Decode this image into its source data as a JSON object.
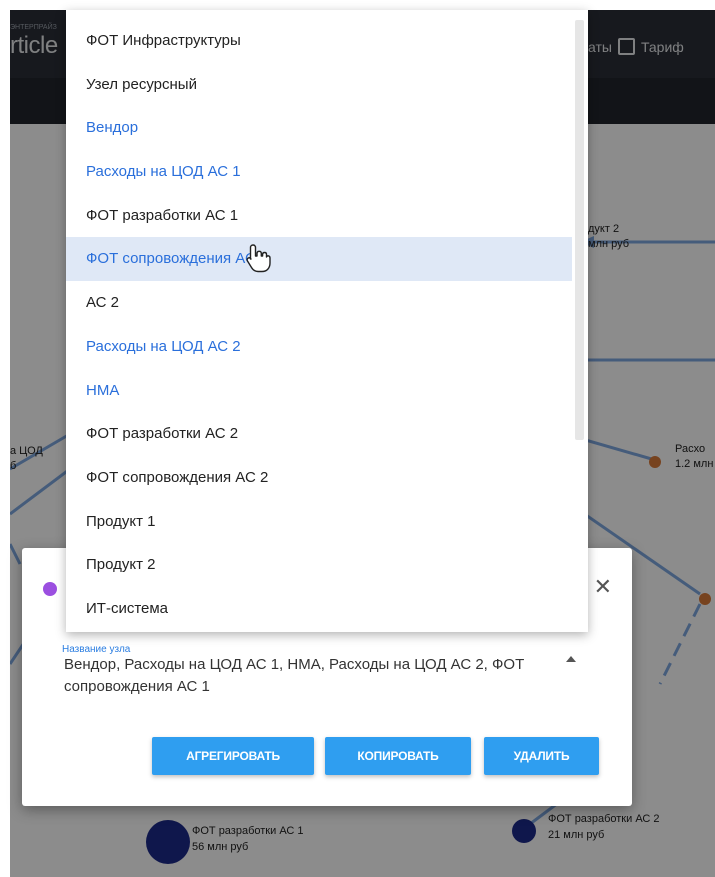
{
  "header": {
    "brand_small": "ЭНТЕРПРАЙЗ",
    "brand": "rticle",
    "check_label_1": "аты",
    "check_label_2": "Тариф"
  },
  "graph": {
    "labels": [
      {
        "text": "дукт 2"
      },
      {
        "text": "млн руб"
      },
      {
        "text": "а ЦОД"
      },
      {
        "text": "б"
      },
      {
        "text": "Расхо"
      },
      {
        "text": "1.2 млн"
      },
      {
        "text": "ФОТ разработки АС 1"
      },
      {
        "text": "56 млн руб"
      },
      {
        "text": "ФОТ разработки АС 2"
      },
      {
        "text": "21 млн руб"
      }
    ]
  },
  "dropdown": {
    "items": [
      {
        "label": "ФОТ Инфраструктуры",
        "color": "default",
        "highlighted": false
      },
      {
        "label": "Узел ресурсный",
        "color": "default",
        "highlighted": false
      },
      {
        "label": "Вендор",
        "color": "blue",
        "highlighted": false
      },
      {
        "label": "Расходы на ЦОД АС 1",
        "color": "blue",
        "highlighted": false
      },
      {
        "label": "ФОТ разработки АС 1",
        "color": "default",
        "highlighted": false
      },
      {
        "label": "ФОТ сопровождения АС 1",
        "color": "blue",
        "highlighted": true
      },
      {
        "label": "АС 2",
        "color": "default",
        "highlighted": false
      },
      {
        "label": "Расходы на ЦОД АС 2",
        "color": "blue",
        "highlighted": false
      },
      {
        "label": "НМА",
        "color": "blue",
        "highlighted": false
      },
      {
        "label": "ФОТ разработки АС 2",
        "color": "default",
        "highlighted": false
      },
      {
        "label": "ФОТ сопровождения АС 2",
        "color": "default",
        "highlighted": false
      },
      {
        "label": "Продукт 1",
        "color": "default",
        "highlighted": false
      },
      {
        "label": "Продукт 2",
        "color": "default",
        "highlighted": false
      },
      {
        "label": "ИТ-система",
        "color": "default",
        "highlighted": false
      }
    ]
  },
  "dialog": {
    "close_glyph": "✕",
    "field_caption": "Название узла",
    "field_value": "Вендор, Расходы на ЦОД АС 1, НМА, Расходы на ЦОД АС 2, ФОТ сопровождения АС 1",
    "buttons": {
      "aggregate": "АГРЕГИРОВАТЬ",
      "copy": "КОПИРОВАТЬ",
      "delete": "УДАЛИТЬ"
    }
  },
  "colors": {
    "accent": "#2f9ef0",
    "link_blue": "#2a6fdb",
    "highlight": "#dfe8f6",
    "node_dot_purple": "#9b4fe0",
    "node_orange": "#d97a3a",
    "node_navy": "#1d2a8a",
    "edge_blue": "#7fa8e0"
  }
}
